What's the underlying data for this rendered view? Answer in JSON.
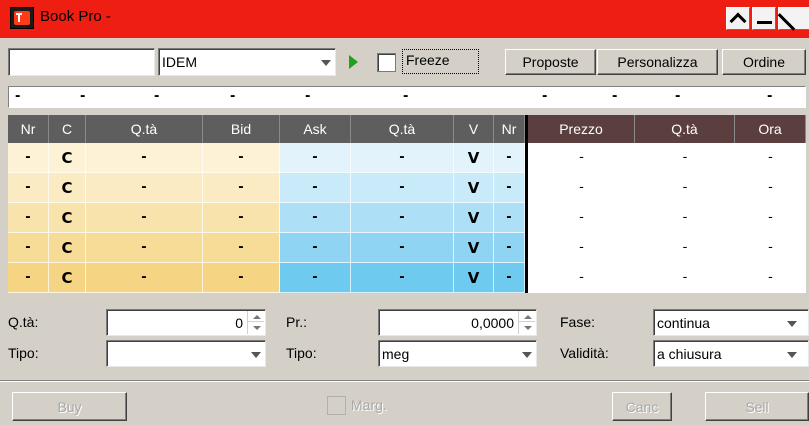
{
  "window": {
    "title": "Book Pro -"
  },
  "toolbar": {
    "symbol_value": "",
    "market_value": "IDEM",
    "freeze_label": "Freeze",
    "proposte_label": "Proposte",
    "personalizza_label": "Personalizza",
    "ordine_label": "Ordine"
  },
  "summary_strip": [
    "-",
    "-",
    "-",
    "-",
    "-",
    "-",
    "-",
    "-",
    "-",
    "-"
  ],
  "book": {
    "headers": [
      "Nr",
      "C",
      "Q.tà",
      "Bid",
      "Ask",
      "Q.tà",
      "V",
      "Nr"
    ],
    "rows": [
      [
        "-",
        "C",
        "-",
        "-",
        "-",
        "-",
        "V",
        "-"
      ],
      [
        "-",
        "C",
        "-",
        "-",
        "-",
        "-",
        "V",
        "-"
      ],
      [
        "-",
        "C",
        "-",
        "-",
        "-",
        "-",
        "V",
        "-"
      ],
      [
        "-",
        "C",
        "-",
        "-",
        "-",
        "-",
        "V",
        "-"
      ],
      [
        "-",
        "C",
        "-",
        "-",
        "-",
        "-",
        "V",
        "-"
      ]
    ],
    "bid_colors": [
      "#fdf1d6",
      "#fbebc3",
      "#f9e3ad",
      "#f7dc98",
      "#f5d584"
    ],
    "ask_colors": [
      "#e2f3fb",
      "#c9eaf8",
      "#ade0f6",
      "#8fd5f3",
      "#6fcaf0"
    ]
  },
  "trades": {
    "headers": [
      "Prezzo",
      "Q.tà",
      "Ora"
    ],
    "rows": [
      [
        "-",
        "-",
        "-"
      ],
      [
        "-",
        "-",
        "-"
      ],
      [
        "-",
        "-",
        "-"
      ],
      [
        "-",
        "-",
        "-"
      ],
      [
        "-",
        "-",
        "-"
      ]
    ]
  },
  "order_form": {
    "qty_label": "Q.tà:",
    "qty_value": "0",
    "price_label": "Pr.:",
    "price_value": "0,0000",
    "phase_label": "Fase:",
    "phase_value": "continua",
    "type_label": "Tipo:",
    "type_value": "",
    "type2_label": "Tipo:",
    "type2_value": "meg",
    "validity_label": "Validità:",
    "validity_value": "a chiusura"
  },
  "footer": {
    "buy_label": "Buy",
    "marg_label": "Marg.",
    "canc_label": "Canc",
    "sell_label": "Sell"
  },
  "colors": {
    "titlebar": "#ef1e13",
    "header_left": "#5e5e5e",
    "header_right": "#5b3e3e",
    "play_green": "#1ca21c"
  }
}
